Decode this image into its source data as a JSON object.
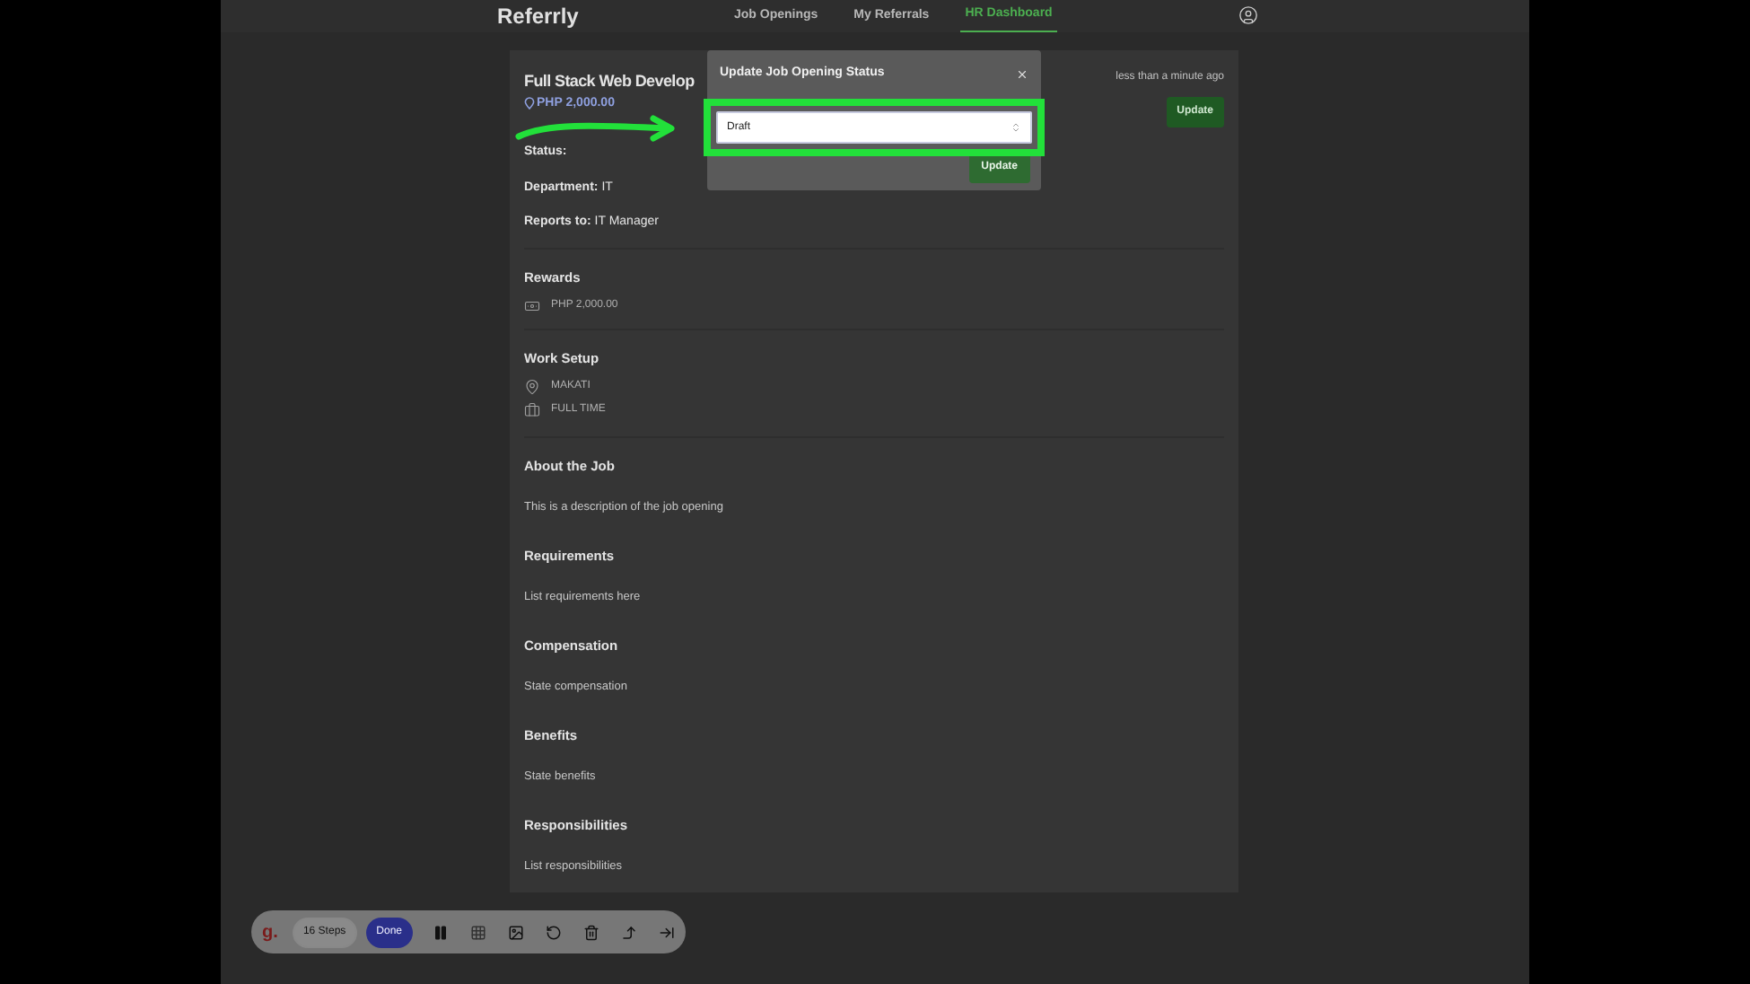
{
  "nav": {
    "logo": "Referrly",
    "links": [
      {
        "label": "Job Openings",
        "selected": false
      },
      {
        "label": "My Referrals",
        "selected": false
      },
      {
        "label": "HR Dashboard",
        "selected": true
      }
    ]
  },
  "job": {
    "title": "Full Stack Web Develop",
    "reward_amount": "PHP 2,000.00",
    "updated": "less than a minute ago",
    "update_button": "Update",
    "fields": [
      {
        "label": "Status:"
      },
      {
        "label": "Department:",
        "value": "IT"
      },
      {
        "label": "Reports to:",
        "value": "IT Manager"
      }
    ],
    "rewards": {
      "heading": "Rewards",
      "items": [
        {
          "kind": "money",
          "text": "PHP 2,000.00"
        }
      ]
    },
    "work_setup": {
      "heading": "Work Setup",
      "items": [
        {
          "kind": "location",
          "text": "MAKATI"
        },
        {
          "kind": "briefcase",
          "text": "FULL TIME"
        }
      ]
    },
    "sections": [
      {
        "heading": "About the Job",
        "text": "This is a description of the job opening"
      },
      {
        "heading": "Requirements",
        "text": "List requirements here"
      },
      {
        "heading": "Compensation",
        "text": "State compensation"
      },
      {
        "heading": "Benefits",
        "text": "State benefits"
      },
      {
        "heading": "Responsibilities",
        "text": "List responsibilities"
      }
    ]
  },
  "modal": {
    "title": "Update Job Opening Status",
    "select_value": "Draft",
    "button": "Update"
  },
  "recorder": {
    "steps": "16 Steps",
    "done": "Done",
    "logo": "g."
  }
}
